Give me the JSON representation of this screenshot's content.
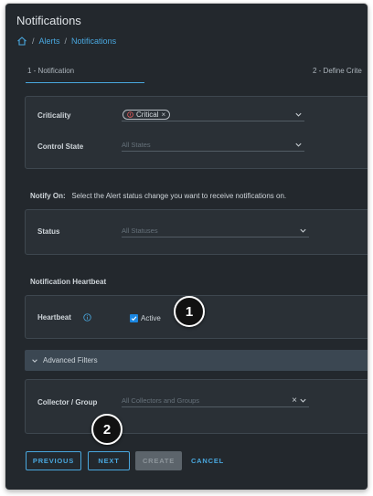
{
  "window": {
    "title": "Notifications"
  },
  "breadcrumb": {
    "home_icon": "home-icon",
    "items": [
      "Alerts",
      "Notifications"
    ]
  },
  "steps": [
    {
      "label": "1 - Notification"
    },
    {
      "label": "2 - Define Crite"
    }
  ],
  "filters": {
    "criticality": {
      "label": "Criticality",
      "chip": "Critical",
      "chip_icon": "alert-circle-icon"
    },
    "control_state": {
      "label": "Control State",
      "placeholder": "All States"
    }
  },
  "notify_on": {
    "label": "Notify On:",
    "description": "Select the Alert status change you want to receive notifications on."
  },
  "status": {
    "label": "Status",
    "placeholder": "All Statuses"
  },
  "heartbeat_section": {
    "title": "Notification Heartbeat"
  },
  "heartbeat": {
    "label": "Heartbeat",
    "checkbox_label": "Active",
    "checked": true
  },
  "advanced_filters": {
    "label": "Advanced Filters"
  },
  "collector_group": {
    "label": "Collector / Group",
    "placeholder": "All Collectors and Groups"
  },
  "buttons": {
    "previous": "PREVIOUS",
    "next": "NEXT",
    "create": "CREATE",
    "cancel": "CANCEL"
  },
  "callouts": [
    "1",
    "2"
  ],
  "colors": {
    "accent": "#49a7de",
    "background": "#23282d",
    "card": "#2a3036",
    "checkbox": "#1b87e2",
    "critical": "#e35b5b"
  }
}
